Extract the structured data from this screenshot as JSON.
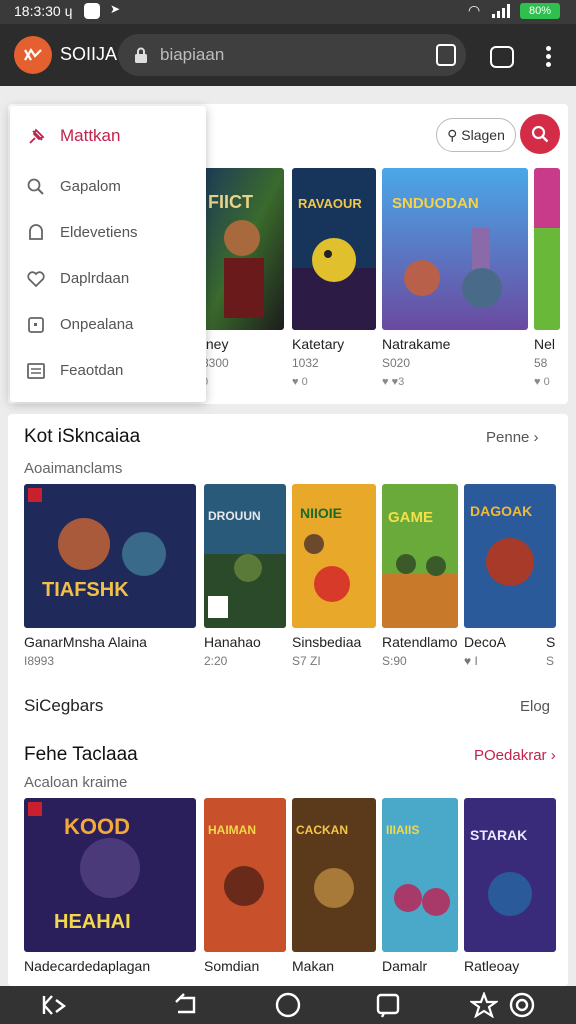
{
  "status_bar": {
    "time": "18:3:30 ɥ",
    "battery": "80%"
  },
  "toolbar": {
    "app_name": "SOIIJA",
    "url_text": "biapiaan"
  },
  "header": {
    "sign_in_label": "Slagen"
  },
  "menu": {
    "items": [
      {
        "label": "Mattkan",
        "icon": "pin-icon",
        "active": true
      },
      {
        "label": "Gapalom",
        "icon": "search-icon"
      },
      {
        "label": "Eldevetiens",
        "icon": "bell-icon"
      },
      {
        "label": "Daplrdaan",
        "icon": "heart-icon"
      },
      {
        "label": "Onpealana",
        "icon": "square-icon"
      },
      {
        "label": "Feaotdan",
        "icon": "list-icon"
      }
    ]
  },
  "top_row": {
    "games": [
      {
        "title": "tney",
        "meta": "8300",
        "meta2": "0"
      },
      {
        "title": "Katetary",
        "meta": "1032",
        "meta2": "♥ 0"
      },
      {
        "title": "Natrakame",
        "meta": "S020",
        "meta2": "♥ ♥3"
      },
      {
        "title": "Nel",
        "meta": "58",
        "meta2": "♥ 0"
      }
    ]
  },
  "section1": {
    "title": "Kot iSkncaiaa",
    "subtitle": "Aoaimanclams",
    "link": "Penne",
    "games": [
      {
        "title": "GanarMnsha Alaina",
        "meta": "I8993"
      },
      {
        "title": "Hanahao",
        "meta": "2:20"
      },
      {
        "title": "Sinsbediaa",
        "meta": "S7 ZI"
      },
      {
        "title": "Ratendlamo",
        "meta": "S:90"
      },
      {
        "title": "DecoA",
        "meta": "♥ I"
      },
      {
        "title": "S",
        "meta": "S"
      }
    ]
  },
  "section_mini": {
    "title": "SiCegbars",
    "link": "Elog"
  },
  "section2": {
    "title": "Fehe Taclaaa",
    "subtitle": "Acaloan kraime",
    "link": "POedakrar",
    "games": [
      {
        "title": "Nadecardedaplagan"
      },
      {
        "title": "Somdian"
      },
      {
        "title": "Makan"
      },
      {
        "title": "Damalr"
      },
      {
        "title": "Ratleoay"
      }
    ]
  },
  "colors": {
    "accent": "#c2224c",
    "logo": "#e4612f",
    "toolbar": "#2c2c2c"
  }
}
